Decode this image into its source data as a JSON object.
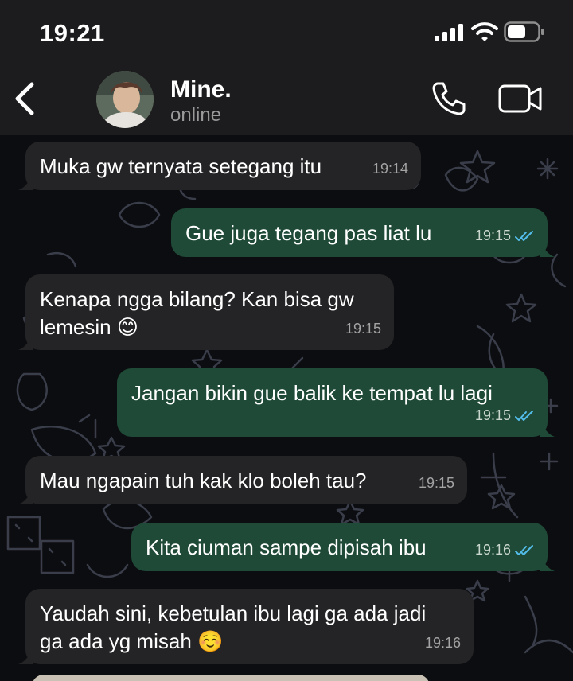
{
  "status_bar": {
    "time": "19:21"
  },
  "header": {
    "contact_name": "Mine.",
    "presence": "online"
  },
  "messages": [
    {
      "direction": "incoming",
      "text": "Muka gw ternyata setegang itu",
      "time": "19:14"
    },
    {
      "direction": "outgoing",
      "text": "Gue juga tegang pas liat lu",
      "time": "19:15",
      "read": true
    },
    {
      "direction": "incoming",
      "text": "Kenapa ngga bilang? Kan bisa gw",
      "text2": "lemesin 😊",
      "time": "19:15"
    },
    {
      "direction": "outgoing",
      "text": "Jangan bikin gue balik ke tempat lu lagi",
      "time": "19:15",
      "read": true
    },
    {
      "direction": "incoming",
      "text": "Mau ngapain tuh kak klo boleh tau?",
      "time": "19:15"
    },
    {
      "direction": "outgoing",
      "text": "Kita ciuman sampe dipisah ibu",
      "time": "19:16",
      "read": true
    },
    {
      "direction": "incoming",
      "text": "Yaudah sini, kebetulan ibu lagi ga ada jadi",
      "text2": "ga ada yg misah ☺️",
      "time": "19:16"
    }
  ],
  "icons": {
    "back": "chevron-left-icon",
    "call": "phone-icon",
    "video": "video-camera-icon",
    "read_receipt": "double-check-icon"
  },
  "colors": {
    "header_bg": "#1c1c1e",
    "incoming_bubble": "#242426",
    "outgoing_bubble": "#1f4a37",
    "read_tick": "#53bdeb",
    "chat_bg": "#0c0d10"
  }
}
